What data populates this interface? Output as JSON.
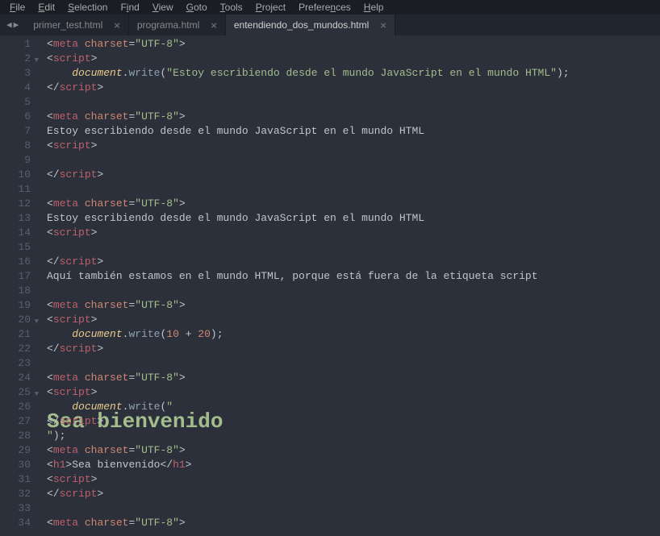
{
  "menu": {
    "file": "File",
    "edit": "Edit",
    "selection": "Selection",
    "find": "Find",
    "view": "View",
    "goto": "Goto",
    "tools": "Tools",
    "project": "Project",
    "preferences": "Preferences",
    "help": "Help"
  },
  "tabs": [
    {
      "label": "primer_test.html",
      "active": false
    },
    {
      "label": "programa.html",
      "active": false
    },
    {
      "label": "entendiendo_dos_mundos.html",
      "active": true
    }
  ],
  "code": {
    "meta_open": "meta",
    "attr_charset": "charset",
    "charset_val": "\"UTF-8\"",
    "script_tag": "script",
    "h1_tag": "h1",
    "doc_ident": "document",
    "write_fn": "write",
    "dot": ".",
    "str_estoy_js": "\"Estoy escribiendo desde el mundo JavaScript en el mundo HTML\"",
    "txt_estoy": "Estoy escribiendo desde el mundo JavaScript en el mundo HTML",
    "txt_aqui": "Aquí también estamos en el mundo HTML, porque está fuera de la etiqueta script",
    "num_10": "10",
    "op_plus": " + ",
    "num_20": "20",
    "str_h1_bien": "\"<h1>Sea bienvenido</h1>\"",
    "txt_bien": "Sea bienvenido"
  },
  "fold_lines": [
    2,
    20,
    25
  ],
  "line_count": 34
}
